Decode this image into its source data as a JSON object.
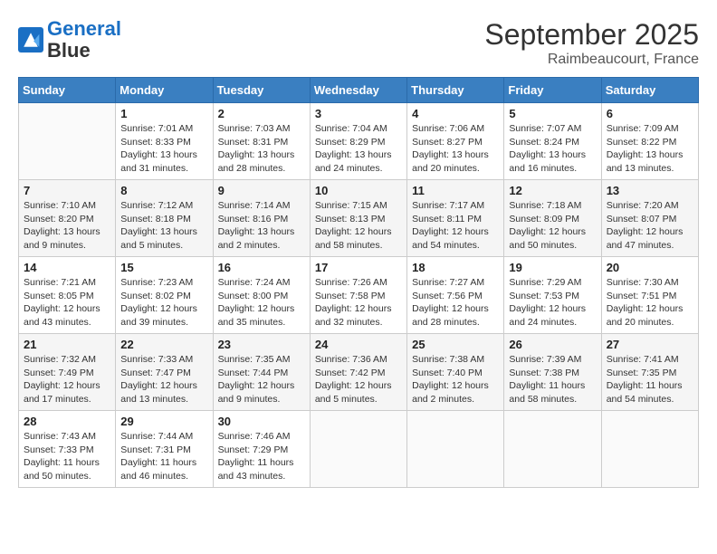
{
  "logo": {
    "text1": "General",
    "text2": "Blue"
  },
  "title": "September 2025",
  "subtitle": "Raimbeaucourt, France",
  "days_header": [
    "Sunday",
    "Monday",
    "Tuesday",
    "Wednesday",
    "Thursday",
    "Friday",
    "Saturday"
  ],
  "weeks": [
    [
      {
        "num": "",
        "sunrise": "",
        "sunset": "",
        "daylight": ""
      },
      {
        "num": "1",
        "sunrise": "Sunrise: 7:01 AM",
        "sunset": "Sunset: 8:33 PM",
        "daylight": "Daylight: 13 hours and 31 minutes."
      },
      {
        "num": "2",
        "sunrise": "Sunrise: 7:03 AM",
        "sunset": "Sunset: 8:31 PM",
        "daylight": "Daylight: 13 hours and 28 minutes."
      },
      {
        "num": "3",
        "sunrise": "Sunrise: 7:04 AM",
        "sunset": "Sunset: 8:29 PM",
        "daylight": "Daylight: 13 hours and 24 minutes."
      },
      {
        "num": "4",
        "sunrise": "Sunrise: 7:06 AM",
        "sunset": "Sunset: 8:27 PM",
        "daylight": "Daylight: 13 hours and 20 minutes."
      },
      {
        "num": "5",
        "sunrise": "Sunrise: 7:07 AM",
        "sunset": "Sunset: 8:24 PM",
        "daylight": "Daylight: 13 hours and 16 minutes."
      },
      {
        "num": "6",
        "sunrise": "Sunrise: 7:09 AM",
        "sunset": "Sunset: 8:22 PM",
        "daylight": "Daylight: 13 hours and 13 minutes."
      }
    ],
    [
      {
        "num": "7",
        "sunrise": "Sunrise: 7:10 AM",
        "sunset": "Sunset: 8:20 PM",
        "daylight": "Daylight: 13 hours and 9 minutes."
      },
      {
        "num": "8",
        "sunrise": "Sunrise: 7:12 AM",
        "sunset": "Sunset: 8:18 PM",
        "daylight": "Daylight: 13 hours and 5 minutes."
      },
      {
        "num": "9",
        "sunrise": "Sunrise: 7:14 AM",
        "sunset": "Sunset: 8:16 PM",
        "daylight": "Daylight: 13 hours and 2 minutes."
      },
      {
        "num": "10",
        "sunrise": "Sunrise: 7:15 AM",
        "sunset": "Sunset: 8:13 PM",
        "daylight": "Daylight: 12 hours and 58 minutes."
      },
      {
        "num": "11",
        "sunrise": "Sunrise: 7:17 AM",
        "sunset": "Sunset: 8:11 PM",
        "daylight": "Daylight: 12 hours and 54 minutes."
      },
      {
        "num": "12",
        "sunrise": "Sunrise: 7:18 AM",
        "sunset": "Sunset: 8:09 PM",
        "daylight": "Daylight: 12 hours and 50 minutes."
      },
      {
        "num": "13",
        "sunrise": "Sunrise: 7:20 AM",
        "sunset": "Sunset: 8:07 PM",
        "daylight": "Daylight: 12 hours and 47 minutes."
      }
    ],
    [
      {
        "num": "14",
        "sunrise": "Sunrise: 7:21 AM",
        "sunset": "Sunset: 8:05 PM",
        "daylight": "Daylight: 12 hours and 43 minutes."
      },
      {
        "num": "15",
        "sunrise": "Sunrise: 7:23 AM",
        "sunset": "Sunset: 8:02 PM",
        "daylight": "Daylight: 12 hours and 39 minutes."
      },
      {
        "num": "16",
        "sunrise": "Sunrise: 7:24 AM",
        "sunset": "Sunset: 8:00 PM",
        "daylight": "Daylight: 12 hours and 35 minutes."
      },
      {
        "num": "17",
        "sunrise": "Sunrise: 7:26 AM",
        "sunset": "Sunset: 7:58 PM",
        "daylight": "Daylight: 12 hours and 32 minutes."
      },
      {
        "num": "18",
        "sunrise": "Sunrise: 7:27 AM",
        "sunset": "Sunset: 7:56 PM",
        "daylight": "Daylight: 12 hours and 28 minutes."
      },
      {
        "num": "19",
        "sunrise": "Sunrise: 7:29 AM",
        "sunset": "Sunset: 7:53 PM",
        "daylight": "Daylight: 12 hours and 24 minutes."
      },
      {
        "num": "20",
        "sunrise": "Sunrise: 7:30 AM",
        "sunset": "Sunset: 7:51 PM",
        "daylight": "Daylight: 12 hours and 20 minutes."
      }
    ],
    [
      {
        "num": "21",
        "sunrise": "Sunrise: 7:32 AM",
        "sunset": "Sunset: 7:49 PM",
        "daylight": "Daylight: 12 hours and 17 minutes."
      },
      {
        "num": "22",
        "sunrise": "Sunrise: 7:33 AM",
        "sunset": "Sunset: 7:47 PM",
        "daylight": "Daylight: 12 hours and 13 minutes."
      },
      {
        "num": "23",
        "sunrise": "Sunrise: 7:35 AM",
        "sunset": "Sunset: 7:44 PM",
        "daylight": "Daylight: 12 hours and 9 minutes."
      },
      {
        "num": "24",
        "sunrise": "Sunrise: 7:36 AM",
        "sunset": "Sunset: 7:42 PM",
        "daylight": "Daylight: 12 hours and 5 minutes."
      },
      {
        "num": "25",
        "sunrise": "Sunrise: 7:38 AM",
        "sunset": "Sunset: 7:40 PM",
        "daylight": "Daylight: 12 hours and 2 minutes."
      },
      {
        "num": "26",
        "sunrise": "Sunrise: 7:39 AM",
        "sunset": "Sunset: 7:38 PM",
        "daylight": "Daylight: 11 hours and 58 minutes."
      },
      {
        "num": "27",
        "sunrise": "Sunrise: 7:41 AM",
        "sunset": "Sunset: 7:35 PM",
        "daylight": "Daylight: 11 hours and 54 minutes."
      }
    ],
    [
      {
        "num": "28",
        "sunrise": "Sunrise: 7:43 AM",
        "sunset": "Sunset: 7:33 PM",
        "daylight": "Daylight: 11 hours and 50 minutes."
      },
      {
        "num": "29",
        "sunrise": "Sunrise: 7:44 AM",
        "sunset": "Sunset: 7:31 PM",
        "daylight": "Daylight: 11 hours and 46 minutes."
      },
      {
        "num": "30",
        "sunrise": "Sunrise: 7:46 AM",
        "sunset": "Sunset: 7:29 PM",
        "daylight": "Daylight: 11 hours and 43 minutes."
      },
      {
        "num": "",
        "sunrise": "",
        "sunset": "",
        "daylight": ""
      },
      {
        "num": "",
        "sunrise": "",
        "sunset": "",
        "daylight": ""
      },
      {
        "num": "",
        "sunrise": "",
        "sunset": "",
        "daylight": ""
      },
      {
        "num": "",
        "sunrise": "",
        "sunset": "",
        "daylight": ""
      }
    ]
  ]
}
